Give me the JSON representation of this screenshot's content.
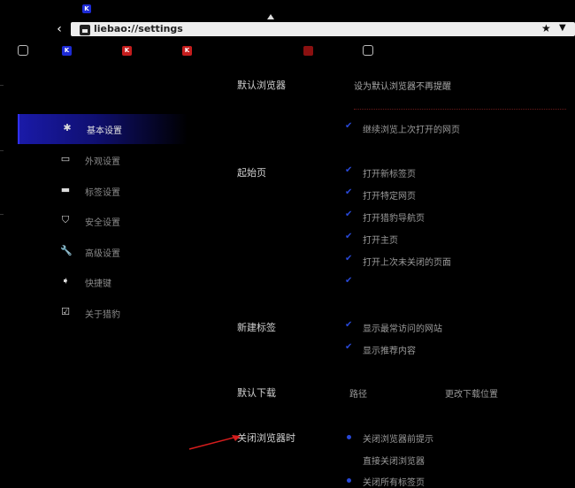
{
  "browser": {
    "url": "liebao://settings",
    "tab_icons": [
      {
        "letter": "K",
        "color": "#1d2bd6"
      }
    ],
    "bookmark_icons": [
      {
        "letter": "K",
        "color": "#1d2bd6"
      },
      {
        "letter": "K",
        "color": "#c41d1d"
      },
      {
        "letter": "K",
        "color": "#c41d1d"
      }
    ]
  },
  "sidebar": {
    "items": [
      {
        "label": "基本设置",
        "icon": "gear-icon",
        "active": true
      },
      {
        "label": "外观设置",
        "icon": "monitor-icon",
        "active": false
      },
      {
        "label": "标签设置",
        "icon": "tabs-icon",
        "active": false
      },
      {
        "label": "安全设置",
        "icon": "shield-icon",
        "active": false
      },
      {
        "label": "高级设置",
        "icon": "wrench-icon",
        "active": false
      },
      {
        "label": "快捷键",
        "icon": "arrow-icon",
        "active": false
      },
      {
        "label": "关于猎豹",
        "icon": "check-box-icon",
        "active": false
      }
    ]
  },
  "content": {
    "default_browser": {
      "label": "默认浏览器",
      "status": "设为默认浏览器不再提醒"
    },
    "startup": {
      "label": "起始页",
      "options": [
        "打开新标签页",
        "打开特定网页",
        "继续浏览上次打开的网页",
        "打开猎豹导航页",
        "打开主页",
        "打开上次未关闭的页面"
      ]
    },
    "new_tab": {
      "label": "新建标签",
      "options": [
        "显示最常访问的网站",
        "显示推荐内容"
      ]
    },
    "download": {
      "label": "默认下载",
      "path_label": "路径",
      "change_button": "更改下载位置"
    },
    "close_behavior": {
      "label": "关闭浏览器时",
      "options": [
        "关闭浏览器前提示",
        "直接关闭浏览器",
        "关闭所有标签页"
      ]
    }
  },
  "colors": {
    "accent": "#2848d8",
    "active_nav": "#1a1aa8",
    "annotation_arrow": "#d61d1d"
  }
}
